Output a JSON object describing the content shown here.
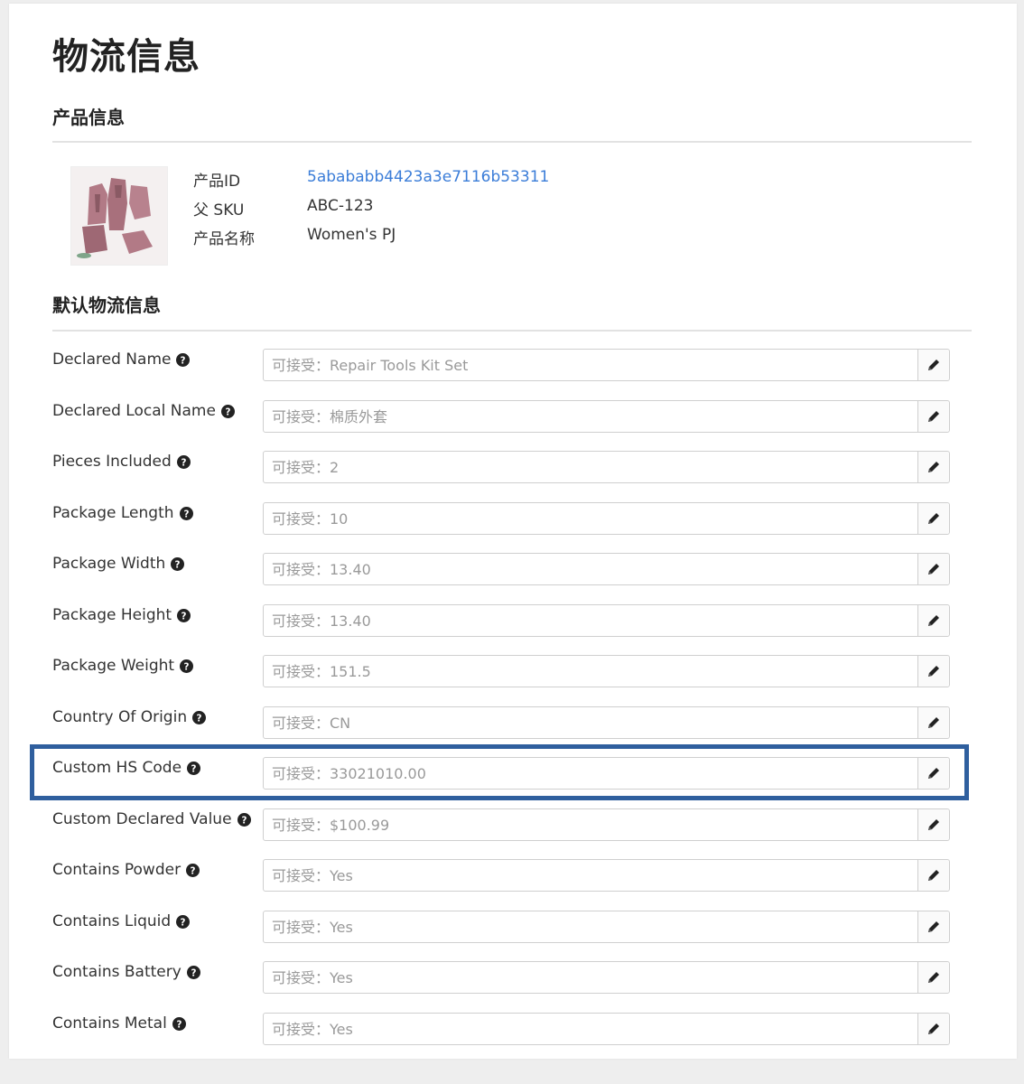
{
  "page_title": "物流信息",
  "product_section": {
    "title": "产品信息",
    "thumbnail": "pajama-set-product-image",
    "fields": [
      {
        "label": "产品ID",
        "value": "5abababb4423a3e7116b53311",
        "is_link": true
      },
      {
        "label": "父 SKU",
        "value": "ABC-123",
        "is_link": false
      },
      {
        "label": "产品名称",
        "value": "Women's PJ",
        "is_link": false
      }
    ]
  },
  "logistics_section": {
    "title": "默认物流信息",
    "rows": [
      {
        "label": "Declared Name",
        "placeholder": "可接受：Repair Tools Kit Set"
      },
      {
        "label": "Declared Local Name",
        "placeholder": "可接受：棉质外套"
      },
      {
        "label": "Pieces Included",
        "placeholder": "可接受：2"
      },
      {
        "label": "Package Length",
        "placeholder": "可接受：10"
      },
      {
        "label": "Package Width",
        "placeholder": "可接受：13.40"
      },
      {
        "label": "Package Height",
        "placeholder": "可接受：13.40"
      },
      {
        "label": "Package Weight",
        "placeholder": "可接受：151.5"
      },
      {
        "label": "Country Of Origin",
        "placeholder": "可接受：CN"
      },
      {
        "label": "Custom HS Code",
        "placeholder": "可接受：33021010.00"
      },
      {
        "label": "Custom Declared Value",
        "placeholder": "可接受：$100.99"
      },
      {
        "label": "Contains Powder",
        "placeholder": "可接受：Yes"
      },
      {
        "label": "Contains Liquid",
        "placeholder": "可接受：Yes"
      },
      {
        "label": "Contains Battery",
        "placeholder": "可接受：Yes"
      },
      {
        "label": "Contains Metal",
        "placeholder": "可接受：Yes"
      }
    ]
  },
  "icons": {
    "help": "question-circle-icon",
    "edit": "pencil-icon"
  },
  "colors": {
    "link": "#3b7dd8",
    "highlight": "#2f5f9e"
  }
}
